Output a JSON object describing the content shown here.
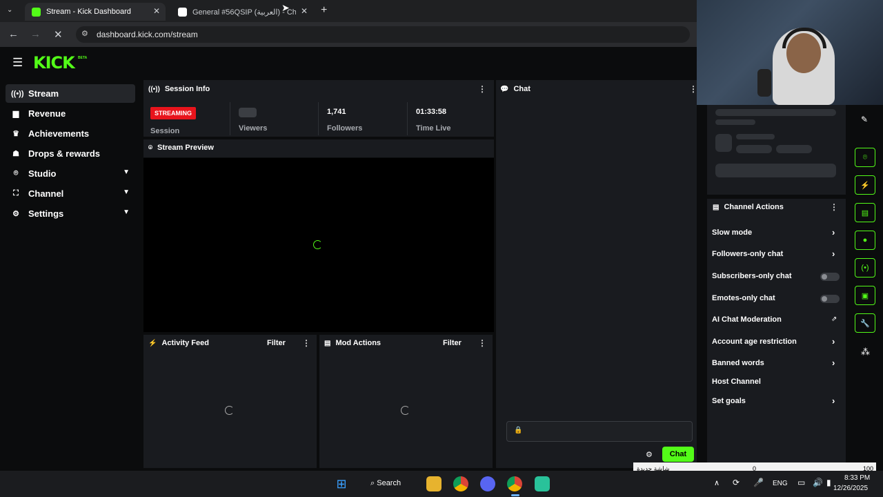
{
  "browser": {
    "tabs": [
      {
        "title": "Stream - Kick Dashboard",
        "active": true
      },
      {
        "title": "General #56QSIP (العربية) - Ch",
        "active": false
      }
    ],
    "new_tab": "+",
    "url": "dashboard.kick.com/stream"
  },
  "kick": {
    "logo": "KICK",
    "logo_badge": "BETA"
  },
  "sidebar": {
    "items": [
      {
        "label": "Stream",
        "icon": "broadcast-icon",
        "active": true
      },
      {
        "label": "Revenue",
        "icon": "chart-icon"
      },
      {
        "label": "Achievements",
        "icon": "trophy-icon"
      },
      {
        "label": "Drops & rewards",
        "icon": "gift-icon"
      },
      {
        "label": "Studio",
        "icon": "studio-icon",
        "expandable": true
      },
      {
        "label": "Channel",
        "icon": "channel-icon",
        "expandable": true
      },
      {
        "label": "Settings",
        "icon": "gear-icon",
        "expandable": true
      }
    ]
  },
  "session": {
    "title": "Session Info",
    "status_badge": "STREAMING",
    "session_label": "Session",
    "viewers_label": "Viewers",
    "followers_value": "1,741",
    "followers_label": "Followers",
    "time_value": "01:33:58",
    "time_label": "Time Live"
  },
  "preview": {
    "title": "Stream Preview"
  },
  "activity": {
    "title": "Activity Feed",
    "filter": "Filter"
  },
  "mod": {
    "title": "Mod Actions",
    "filter": "Filter"
  },
  "chat": {
    "title": "Chat",
    "send_label": "Chat"
  },
  "channel_actions": {
    "title": "Channel Actions",
    "items": [
      {
        "label": "Slow mode",
        "control": "arrow"
      },
      {
        "label": "Followers-only chat",
        "control": "arrow"
      },
      {
        "label": "Subscribers-only chat",
        "control": "toggle"
      },
      {
        "label": "Emotes-only chat",
        "control": "toggle"
      },
      {
        "label": "AI Chat Moderation",
        "control": "external"
      },
      {
        "label": "Account age restriction",
        "control": "arrow"
      },
      {
        "label": "Banned words",
        "control": "arrow"
      },
      {
        "label": "Host Channel",
        "control": "none"
      },
      {
        "label": "Set goals",
        "control": "arrow"
      }
    ]
  },
  "overlay_bar": {
    "left_text": "شاشة جديدة",
    "middle_value": "0",
    "right_value": "100"
  },
  "taskbar": {
    "search_label": "Search",
    "lang": "ENG",
    "time": "8:33 PM",
    "date": "12/26/2025"
  },
  "colors": {
    "accent": "#53fc18",
    "live": "#e8141c"
  }
}
